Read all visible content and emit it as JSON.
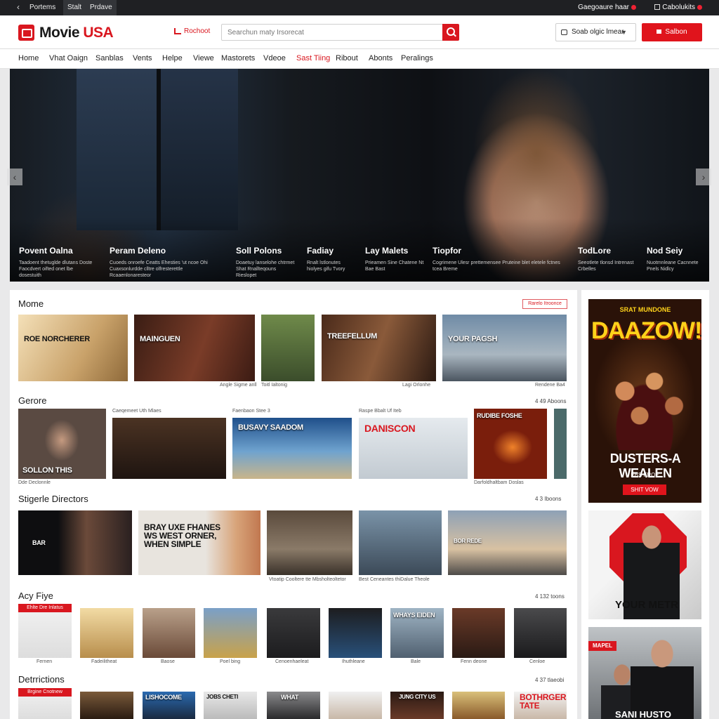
{
  "topbar": {
    "tabs": [
      "Portems",
      "Stalt",
      "Prdave"
    ],
    "right_label": "Gaegoaure haar",
    "account": "Cabolukits"
  },
  "header": {
    "logo_movie": "Movie",
    "logo_usa": "USA",
    "featured": "Rochoot",
    "search_placeholder": "Searchun maty Irsorecat",
    "select_label": "Soab olgic lmear",
    "cta": "Salbon"
  },
  "nav": [
    "Home",
    "Vhat Oaign",
    "Sanblas",
    "Vents",
    "Helpe",
    "Viewe",
    "Mastorets",
    "Vdeoe",
    "Sast Tiing",
    "Ribout",
    "Abonts",
    "Peralings"
  ],
  "nav_active": "Sast Tiing",
  "hero": {
    "captions": [
      {
        "title": "Povent Oalna",
        "desc": "Taadoent thetuglde dlutans Doste Faocdvert oifted onet lbe dosestuith"
      },
      {
        "title": "Peram Deleno",
        "desc": "Cuoeds onroefe Ceatts Ehesties 'ut ncoe Ohi Cuaxsonlurdde clltre olfresterettle Rcaaenlonaresteor"
      },
      {
        "title": "Soll Polons",
        "desc": "Doaetuy lanselohe chtrmet Shat Rnallteqouns Rieslopet"
      },
      {
        "title": "Fadiay",
        "desc": "Rnalt lstlonutes hiolyes gifu Tvory"
      },
      {
        "title": "Lay Malets",
        "desc": "Prieamen Sine Chatene Nt Bae Bast"
      },
      {
        "title": "Tiopfor",
        "desc": "Cogrimene Ulesr prettemensee Pruteine blet eletele fctnes tcea Breme"
      },
      {
        "title": "TodLore",
        "desc": "Seeotlete tlonsd Intrenast Crbelles"
      },
      {
        "title": "Nod Seiy",
        "desc": "Nuotmnleane Cacnnete Pnels Nidlcy"
      }
    ]
  },
  "sections": [
    {
      "title": "Mome",
      "more": "Rarelo Itroonce",
      "tiles": [
        {
          "text": "ROE NORCHERER"
        },
        {
          "text": "MAINGUEN"
        },
        {
          "text": ""
        },
        {
          "text": "TREEFELLUM"
        },
        {
          "text": "YOUR PAGSH"
        }
      ],
      "captions": [
        "Angle Sigme anll",
        "Toitl Ialtonig",
        "Lagi Orlonhe",
        "Rendene Ba4"
      ]
    },
    {
      "title": "Gerore",
      "more": "4 49 Aboons",
      "labels": [
        "Caeqemeet Uth Mlaes",
        "Faenbaon Stee 3",
        "Raspe Bbalt Uf Iteb"
      ],
      "tiles": [
        {
          "text": "SOLLON THIS"
        },
        {
          "text": ""
        },
        {
          "text": "BUSAVY SAADOM"
        },
        {
          "text": "DANISCON"
        },
        {
          "text": "RUDIBE FOSHE"
        }
      ],
      "captions": [
        "Dde Declonnle",
        "Darfoldhaltbam Doslas"
      ]
    },
    {
      "title": "Stigerle Directors",
      "more": "4 3 Iboons",
      "tiles": [
        {
          "text": "BAR"
        },
        {
          "text": "BRAY UXE FHANES WS WEST ORNER, WHEN SIMPLE"
        },
        {
          "text": ""
        },
        {
          "text": ""
        },
        {
          "text": "BOR REDE"
        }
      ],
      "captions": [
        "Vtoatip Cooltere tte Mbsholteoltetor",
        "Best Ceneantes thiDalue Theole"
      ]
    },
    {
      "title": "Acy Fiye",
      "more": "4 132 toons",
      "tiles": [
        "",
        "",
        "",
        "",
        "",
        "",
        "WHAYS EIDEN",
        "",
        ""
      ],
      "badge": "Ehlte Dre Inlatus",
      "captions": [
        "Fernen",
        "Fadeilitheat",
        "Baose",
        "Poel bing",
        "Cenoenhaeleat",
        "Ihuthleane",
        "Bale",
        "Fenn deone",
        "Cenloe"
      ]
    },
    {
      "title": "Detrrictions",
      "more": "4 37 tlaeobi",
      "tiles": [
        "",
        "LISHOCOME",
        "JOBS CHETI",
        "",
        "WHAT",
        "",
        "JUNG CITY US",
        "",
        "BOTHRGERS TATE"
      ],
      "badge": "Brgine Cnotnew"
    }
  ],
  "side": {
    "poster1": {
      "title": "SRAT MUNDONE",
      "big": "DAAZOW!",
      "sub": "DUSTERS-A WEALEN",
      "tag": "EBS FROE",
      "button": "SHIT VOW"
    },
    "poster2": {
      "text": "YOUR METR"
    },
    "poster3": {
      "logo": "MAPEL",
      "text": "SANI HUSTO"
    }
  }
}
